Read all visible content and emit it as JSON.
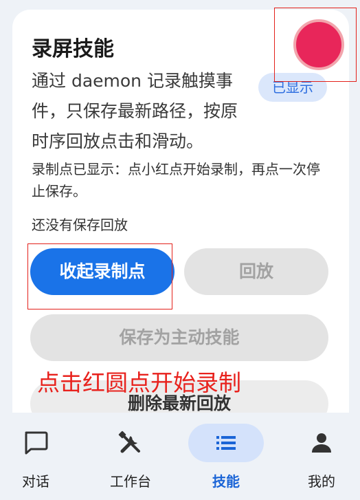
{
  "card": {
    "title": "录屏技能",
    "description": "通过 daemon 记录触摸事件，只保存最新路径，按原时序回放点击和滑动。",
    "badge": "已显示",
    "hint": "录制点已显示：点小红点开始录制，再点一次停止保存。",
    "empty_state": "还没有保存回放"
  },
  "buttons": {
    "collapse": "收起录制点",
    "replay": "回放",
    "save_as_skill": "保存为主动技能",
    "delete_latest": "删除最新回放"
  },
  "annotation": "点击红圆点开始录制",
  "colors": {
    "primary": "#1a73e8",
    "record_dot": "#e8265a",
    "annotation_red": "#e8221d"
  },
  "nav": {
    "items": [
      {
        "label": "对话",
        "icon": "chat-icon"
      },
      {
        "label": "工作台",
        "icon": "tools-icon"
      },
      {
        "label": "技能",
        "icon": "list-icon",
        "active": true
      },
      {
        "label": "我的",
        "icon": "person-icon"
      }
    ]
  }
}
